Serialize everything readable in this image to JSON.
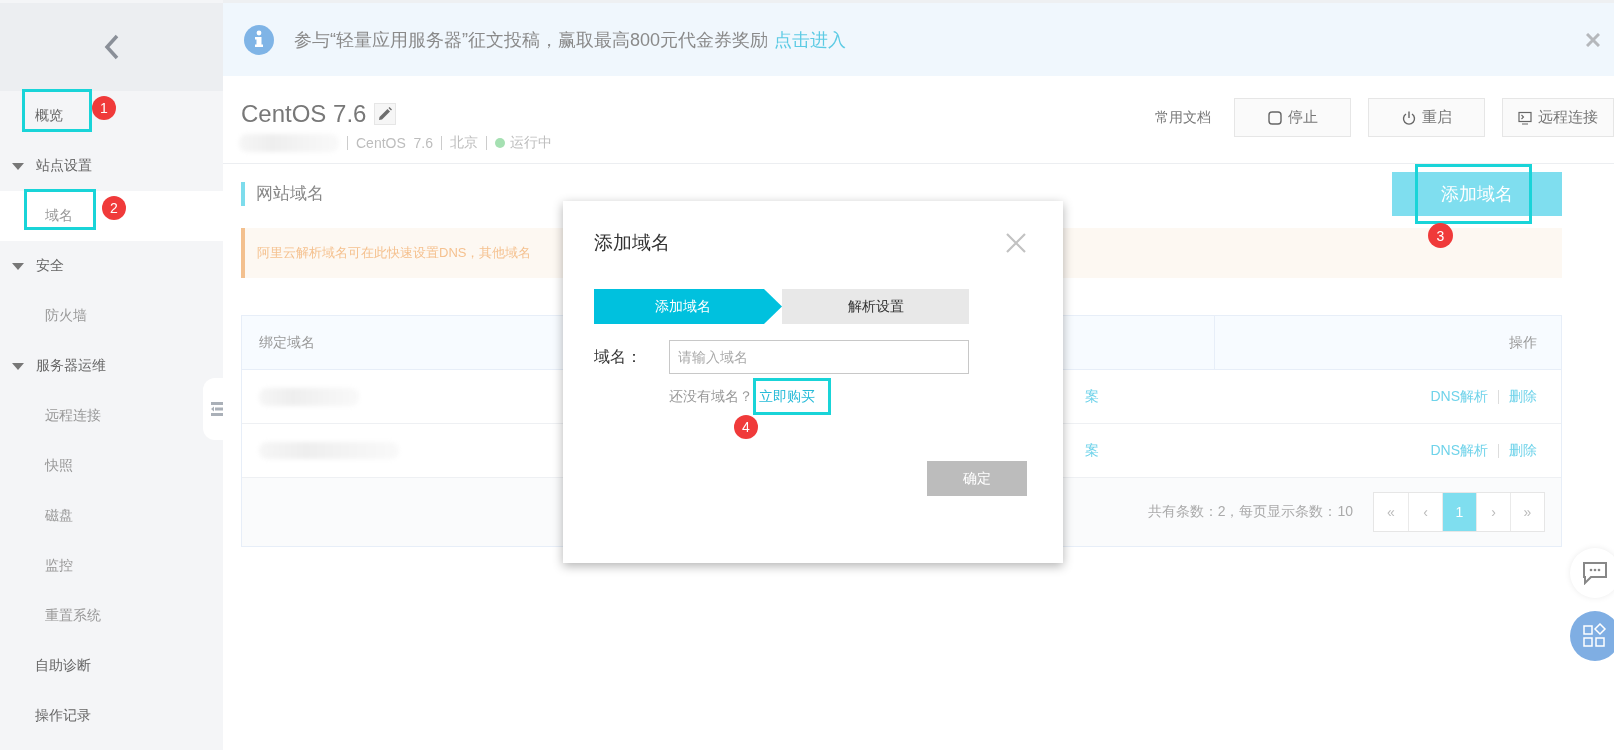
{
  "sidebar": {
    "items": [
      {
        "kind": "item",
        "label": "概览",
        "selected": false,
        "callout": "1"
      },
      {
        "kind": "group",
        "label": "站点设置",
        "expanded": true,
        "children": [
          {
            "kind": "item",
            "label": "域名",
            "selected": true,
            "callout": "2"
          }
        ]
      },
      {
        "kind": "group",
        "label": "安全",
        "expanded": true,
        "children": [
          {
            "kind": "item",
            "label": "防火墙",
            "selected": false
          }
        ]
      },
      {
        "kind": "group",
        "label": "服务器运维",
        "expanded": true,
        "children": [
          {
            "kind": "item",
            "label": "远程连接",
            "selected": false
          },
          {
            "kind": "item",
            "label": "快照",
            "selected": false
          },
          {
            "kind": "item",
            "label": "磁盘",
            "selected": false
          },
          {
            "kind": "item",
            "label": "监控",
            "selected": false
          },
          {
            "kind": "item",
            "label": "重置系统",
            "selected": false
          }
        ]
      },
      {
        "kind": "item",
        "label": "自助诊断",
        "selected": false
      },
      {
        "kind": "item",
        "label": "操作记录",
        "selected": false
      }
    ]
  },
  "banner": {
    "text": "参与“轻量应用服务器”征文投稿，赢取最高800元代金券奖励",
    "link": "点击进入"
  },
  "instance": {
    "title": "CentOS 7.6",
    "os": "CentOS  7.6",
    "region": "北京",
    "status": "运行中"
  },
  "header_actions": {
    "docs": "常用文档",
    "buttons": [
      {
        "kind": "stop",
        "label": "停止"
      },
      {
        "kind": "power",
        "label": "重启"
      },
      {
        "kind": "terminal",
        "label": "远程连接"
      }
    ]
  },
  "section": {
    "title": "网站域名",
    "add_button": {
      "label": "添加域名",
      "callout": "3"
    },
    "alert": "阿里云解析域名可在此快速设置DNS，其他域名"
  },
  "table": {
    "columns": [
      "绑定域名",
      "操作"
    ],
    "rows": [
      {
        "column_2": "案",
        "actions": [
          "DNS解析",
          "删除"
        ]
      },
      {
        "column_2": "案",
        "actions": [
          "DNS解析",
          "删除"
        ]
      }
    ],
    "summary": "共有条数：2，每页显示条数：10",
    "pager": [
      {
        "label": "«",
        "selected": false
      },
      {
        "label": "‹",
        "selected": false
      },
      {
        "label": "1",
        "selected": true
      },
      {
        "label": "›",
        "selected": false
      },
      {
        "label": "»",
        "selected": false
      }
    ]
  },
  "dialog": {
    "title": "添加域名",
    "steps": [
      {
        "label": "添加域名",
        "selected": true
      },
      {
        "label": "解析设置",
        "selected": false
      }
    ],
    "field_label": "域名：",
    "placeholder": "请输入域名",
    "hint": "还没有域名？",
    "link": {
      "label": "立即购买",
      "callout": "4"
    },
    "confirm": {
      "label": "确定",
      "disabled": true
    }
  }
}
